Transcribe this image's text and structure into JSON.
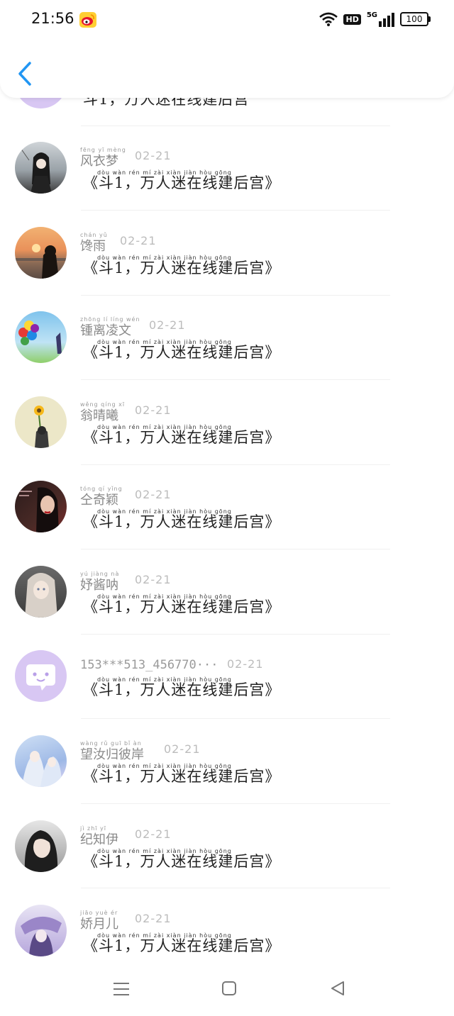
{
  "status_bar": {
    "time": "21:56",
    "hd_label": "HD",
    "network": "5G",
    "battery": "100"
  },
  "header": {
    "back_icon": "chevron-left-icon",
    "accent_color": "#2196F3"
  },
  "message_pinyin": "dòu        wàn rén  mí   zài  xiàn jiàn hòu gōng",
  "messages": [
    {
      "pinyin": "",
      "name": "",
      "date": "",
      "message": "斗1，万人迷在线建后宫",
      "avatar": "purple-chat"
    },
    {
      "pinyin": "fēng  yī  mèng",
      "name": "风衣梦",
      "date": "02-21",
      "message": "《斗1，万人迷在线建后宫》",
      "avatar": "anime-man"
    },
    {
      "pinyin": "chán  yǔ",
      "name": "馋雨",
      "date": "02-21",
      "message": "《斗1，万人迷在线建后宫》",
      "avatar": "sunset-girl"
    },
    {
      "pinyin": "zhōng  lí  líng  wén",
      "name": "锺离凌文",
      "date": "02-21",
      "message": "《斗1，万人迷在线建后宫》",
      "avatar": "balloons"
    },
    {
      "pinyin": "wěng qíng  xī",
      "name": "翁晴曦",
      "date": "02-21",
      "message": "《斗1，万人迷在线建后宫》",
      "avatar": "sunflower"
    },
    {
      "pinyin": "tóng  qí  yǐng",
      "name": "仝奇颖",
      "date": "02-21",
      "message": "《斗1，万人迷在线建后宫》",
      "avatar": "woman-dark"
    },
    {
      "pinyin": "yú  jiàng  nà",
      "name": "妤酱呐",
      "date": "02-21",
      "message": "《斗1，万人迷在线建后宫》",
      "avatar": "anime-girl"
    },
    {
      "pinyin": "",
      "name": "153***513_456770···",
      "date": "02-21",
      "message": "《斗1，万人迷在线建后宫》",
      "avatar": "purple-chat"
    },
    {
      "pinyin": "wàng  rǔ  guī  bǐ  àn",
      "name": "望汝归彼岸",
      "date": "02-21",
      "message": "《斗1，万人迷在线建后宫》",
      "avatar": "fantasy-girls"
    },
    {
      "pinyin": "jì  zhī  yī",
      "name": "纪知伊",
      "date": "02-21",
      "message": "《斗1，万人迷在线建后宫》",
      "avatar": "selfie-girl"
    },
    {
      "pinyin": "jiāo  yuè  ér",
      "name": "娇月儿",
      "date": "02-21",
      "message": "《斗1，万人迷在线建后宫》",
      "avatar": "anime-purple"
    }
  ],
  "nav": {
    "menu_icon": "menu-icon",
    "home_icon": "home-square-icon",
    "back_icon": "back-triangle-icon"
  }
}
